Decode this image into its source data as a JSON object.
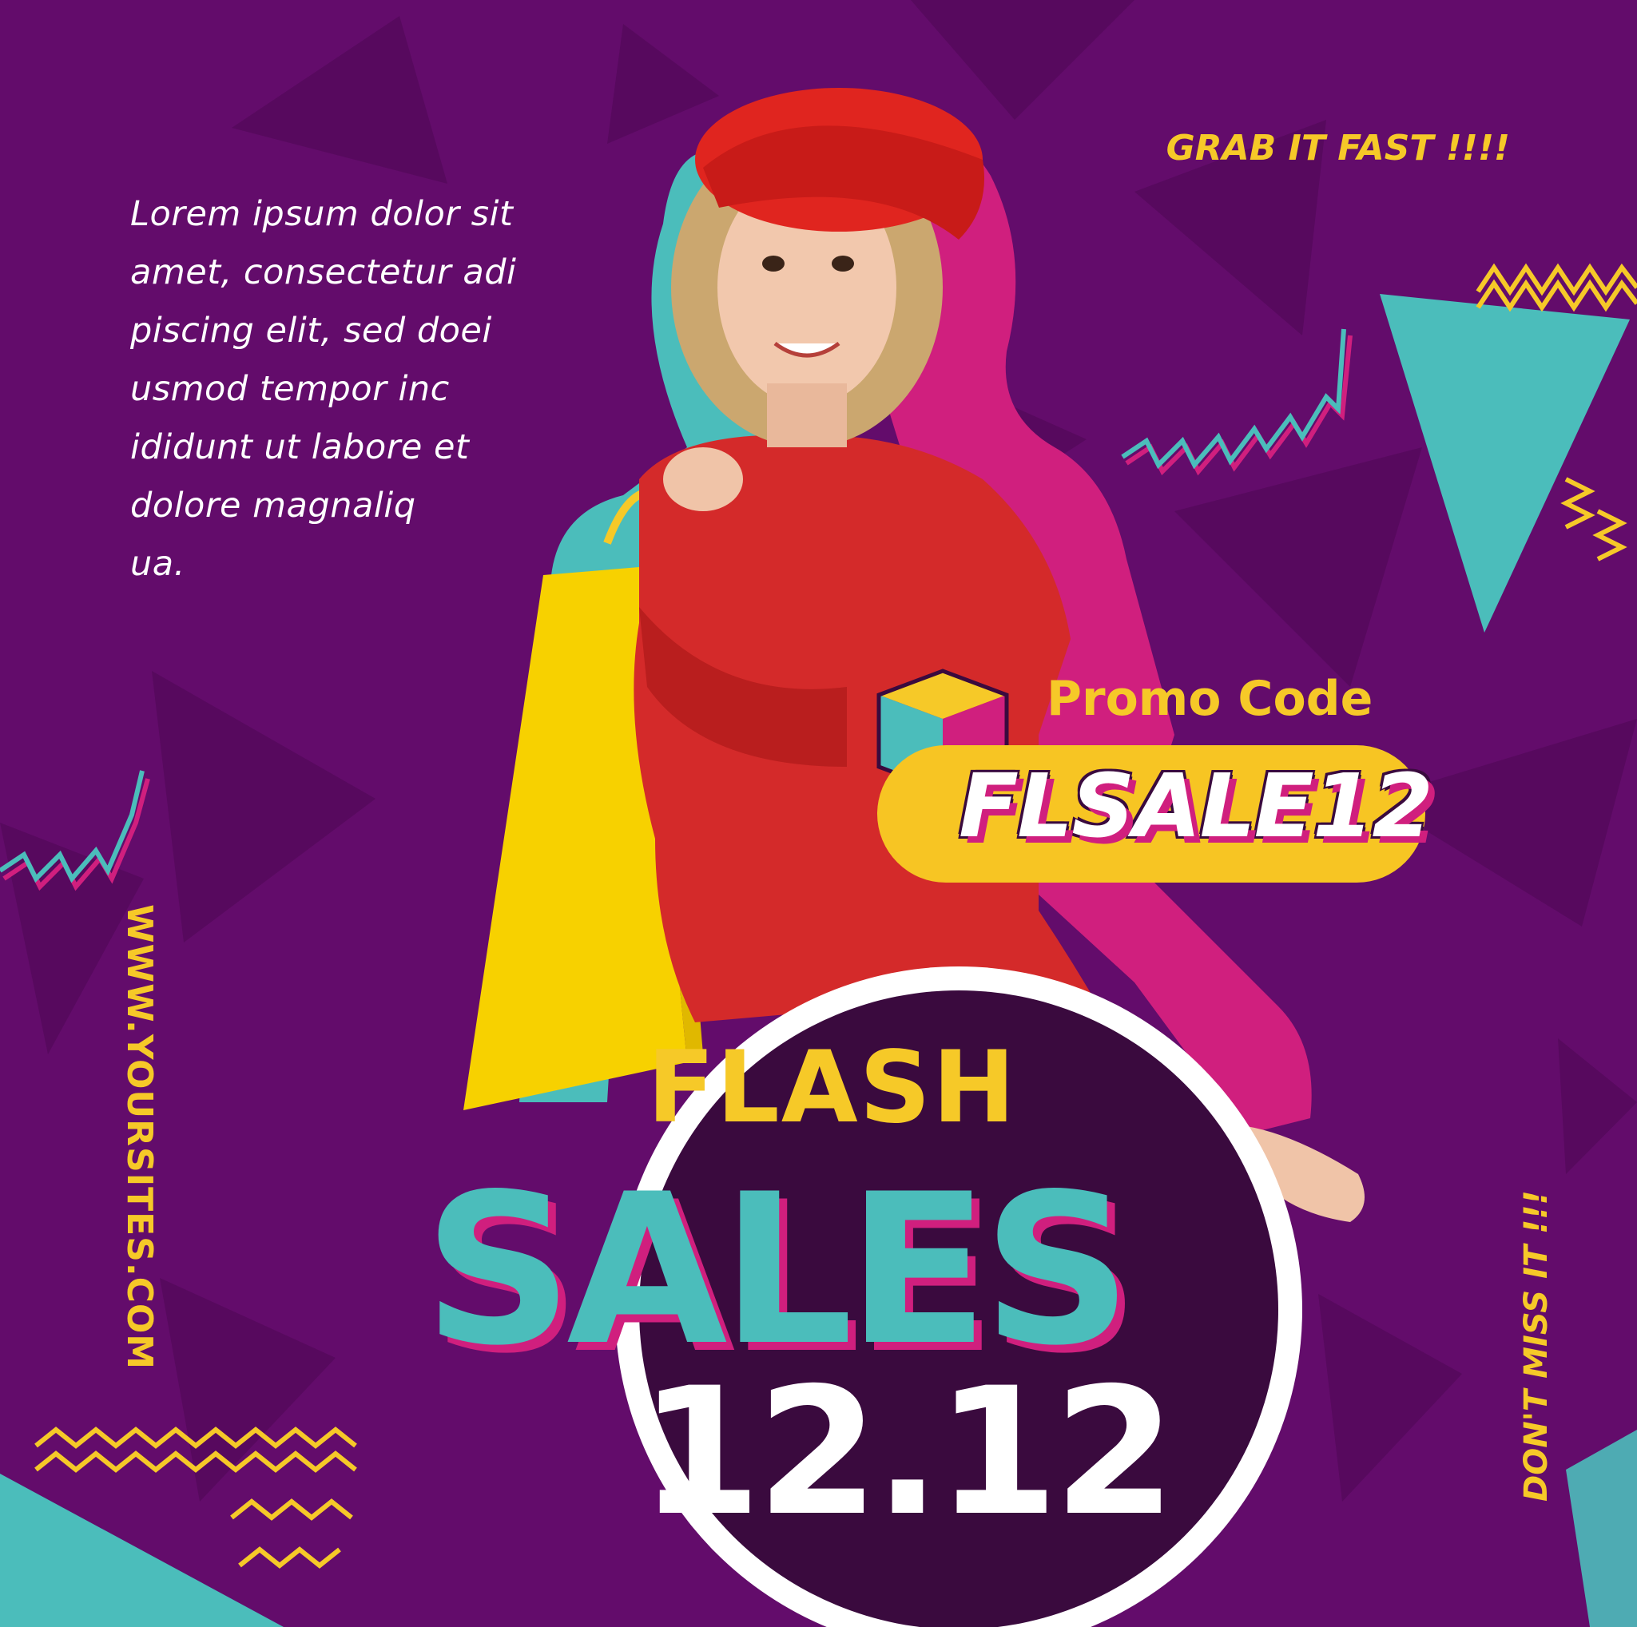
{
  "poster": {
    "body_text": "Lorem ipsum dolor sit\namet, consectetur adi\npiscing elit, sed doei\nusmod tempor inc\nididunt ut labore et\ndolore magnaliq\nua.",
    "top_tagline": "GRAB IT FAST !!!!",
    "promo_label": "Promo Code",
    "promo_code": "FLSALE12",
    "website": "WWW.YOURSITES.COM",
    "side_tagline": "DON'T MISS IT !!!",
    "headline_small": "FLASH",
    "headline_big": "SALES",
    "headline_date": "12.12"
  },
  "colors": {
    "background": "#630c6b",
    "yellow": "#f6c928",
    "teal": "#4bbdbb",
    "pink": "#d01f7e",
    "dark_purple": "#3a0a3e",
    "white": "#ffffff"
  },
  "icons": [
    "cube-icon",
    "zigzag-icon",
    "triangle-icon",
    "shopping-bag-icon"
  ]
}
